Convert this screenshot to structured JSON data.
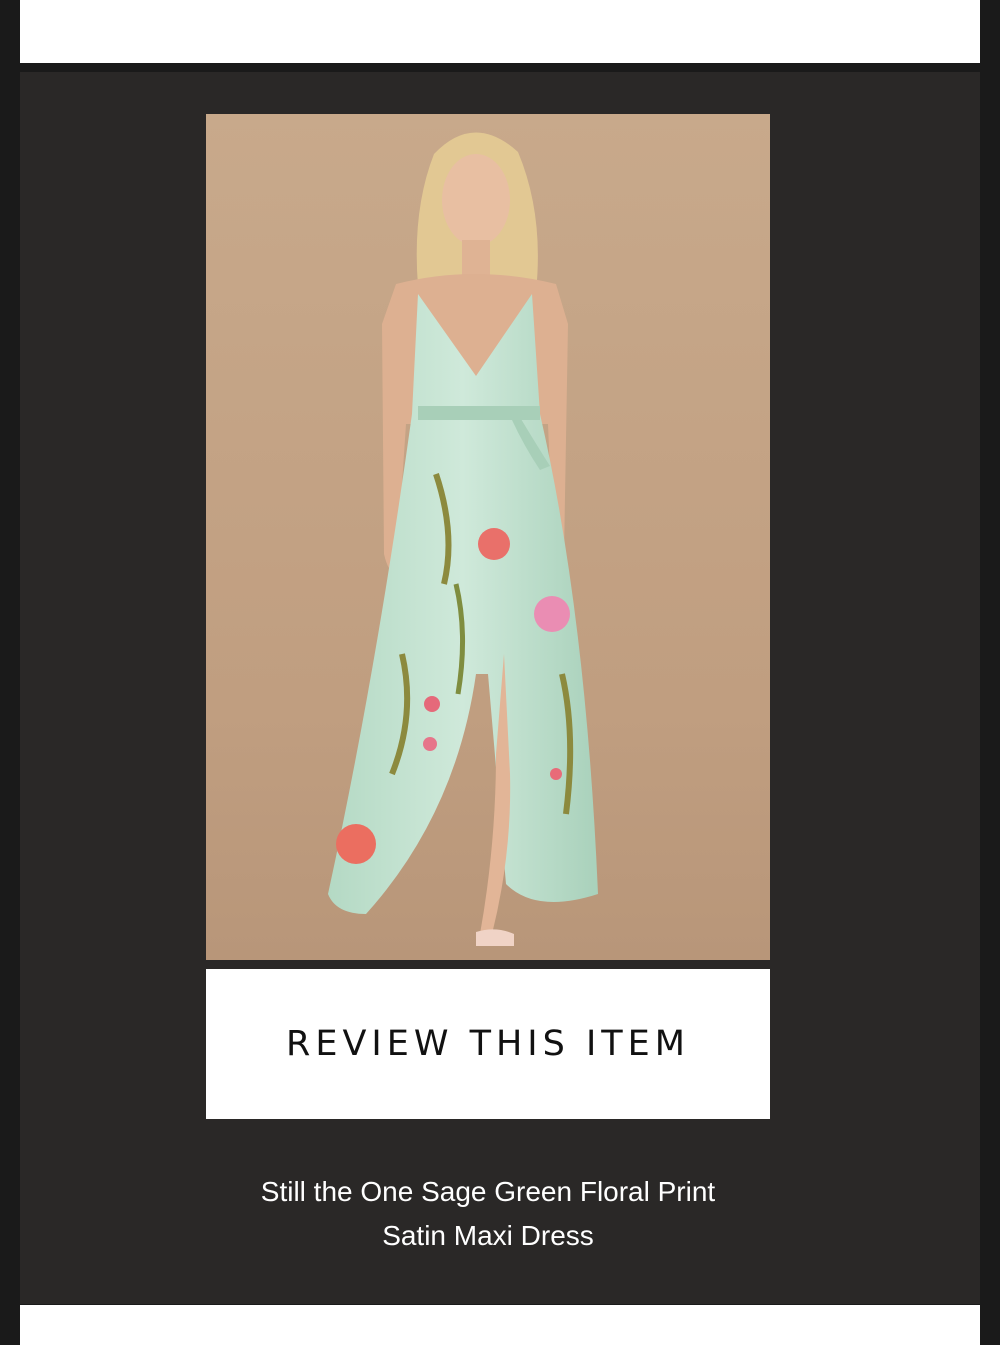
{
  "email": {
    "product": {
      "image_alt": "Model wearing sage green floral print satin maxi dress",
      "review_button_label": "REVIEW THIS ITEM",
      "name_line1": "Still the One Sage Green Floral Print",
      "name_line2": "Satin Maxi Dress"
    }
  },
  "colors": {
    "panel_background": "#2a2827",
    "photo_background": "#c19f80",
    "dress_sage": "#bfe0cc",
    "button_background": "#ffffff"
  }
}
